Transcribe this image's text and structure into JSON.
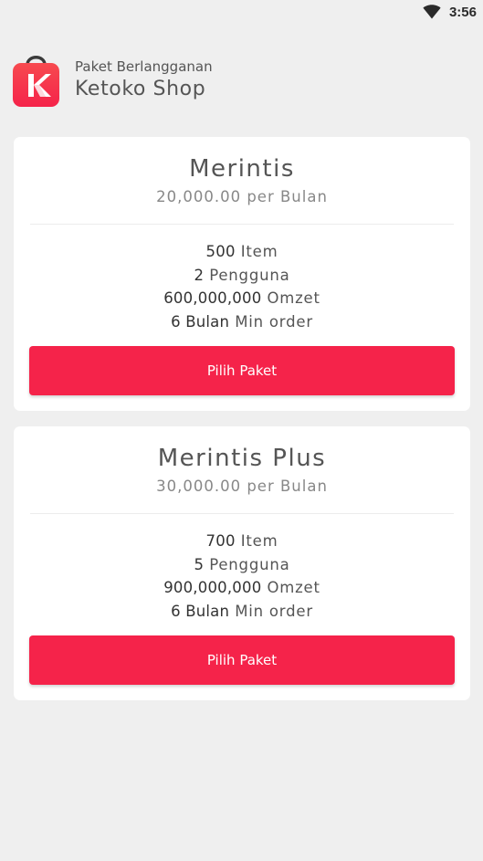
{
  "status_bar": {
    "time": "3:56",
    "icons": [
      "wifi-icon"
    ]
  },
  "header": {
    "subtitle": "Paket Berlangganan",
    "title": "Ketoko Shop",
    "logo_letter": "K",
    "logo_colors": [
      "#f5234a",
      "#f0444f"
    ]
  },
  "colors": {
    "accent": "#f5234a",
    "background": "#efefef",
    "card": "#ffffff"
  },
  "plans": [
    {
      "name": "Merintis",
      "price": "20,000.00 per Bulan",
      "features": [
        {
          "value": "500",
          "label": "Item"
        },
        {
          "value": "2",
          "label": "Pengguna"
        },
        {
          "value": "600,000,000",
          "label": "Omzet"
        },
        {
          "value": "6 Bulan",
          "label": "Min order"
        }
      ],
      "button_label": "Pilih Paket"
    },
    {
      "name": "Merintis Plus",
      "price": "30,000.00 per Bulan",
      "features": [
        {
          "value": "700",
          "label": "Item"
        },
        {
          "value": "5",
          "label": "Pengguna"
        },
        {
          "value": "900,000,000",
          "label": "Omzet"
        },
        {
          "value": "6 Bulan",
          "label": "Min order"
        }
      ],
      "button_label": "Pilih Paket"
    }
  ]
}
